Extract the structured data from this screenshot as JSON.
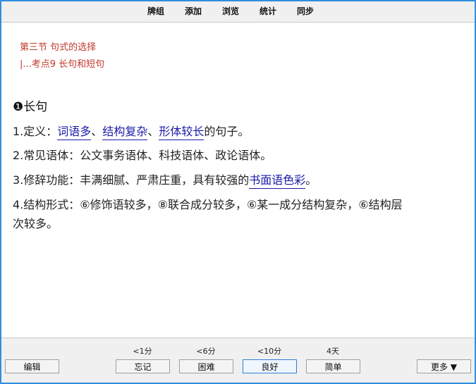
{
  "menu": {
    "items": [
      "牌组",
      "添加",
      "浏览",
      "统计",
      "同步"
    ]
  },
  "content": {
    "breadcrumb_section": "第三节 句式的选择",
    "breadcrumb_point": "|...考点9 长句和短句",
    "heading_bullet": "❶",
    "heading": "长句",
    "line1": {
      "prefix": "1.定义：",
      "term1": "词语多",
      "sep1": "、",
      "term2": "结构复杂",
      "sep2": "、",
      "term3": "形体较长",
      "suffix": "的句子。"
    },
    "line2": "2.常见语体：公文事务语体、科技语体、政论语体。",
    "line3": {
      "prefix": "3.修辞功能：丰满细腻、严肃庄重，具有较强的",
      "term": "书面语色彩",
      "suffix": "。"
    },
    "line4a": "4.结构形式：⑥修饰语较多，⑧联合成分较多，⑥某一成分结构复杂，⑥结构层",
    "line4b": "次较多。"
  },
  "bottom": {
    "edit_label": "编辑",
    "more_label": "更多 ▼",
    "answers": [
      {
        "interval": "<1分",
        "label": "忘记"
      },
      {
        "interval": "<6分",
        "label": "困难"
      },
      {
        "interval": "<10分",
        "label": "良好"
      },
      {
        "interval": "4天",
        "label": "简单"
      }
    ]
  }
}
